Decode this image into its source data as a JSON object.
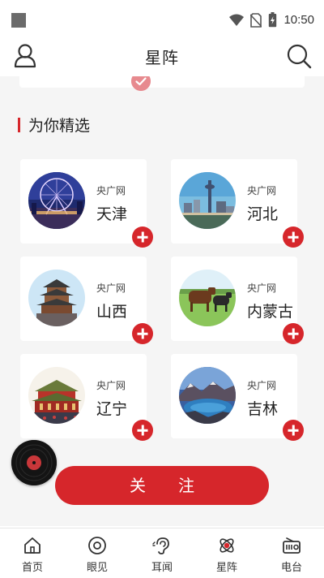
{
  "status_bar": {
    "time": "10:50"
  },
  "header": {
    "title": "星阵"
  },
  "section": {
    "title": "为你精选"
  },
  "cards": [
    {
      "source": "央广网",
      "name": "天津",
      "image": "tianjin-eye-ferris-wheel"
    },
    {
      "source": "央广网",
      "name": "河北",
      "image": "hebei-city-tower"
    },
    {
      "source": "央广网",
      "name": "山西",
      "image": "shanxi-pavilion"
    },
    {
      "source": "央广网",
      "name": "内蒙古",
      "image": "inner-mongolia-cattle"
    },
    {
      "source": "央广网",
      "name": "辽宁",
      "image": "liaoning-palace"
    },
    {
      "source": "央广网",
      "name": "吉林",
      "image": "jilin-tianchi-lake"
    }
  ],
  "follow_button": {
    "label": "关注"
  },
  "bottom_nav": [
    {
      "label": "首页",
      "icon": "home-icon"
    },
    {
      "label": "眼见",
      "icon": "eye-icon"
    },
    {
      "label": "耳闻",
      "icon": "ear-icon"
    },
    {
      "label": "星阵",
      "icon": "star-array-icon"
    },
    {
      "label": "电台",
      "icon": "radio-icon"
    }
  ],
  "colors": {
    "accent": "#d6262b",
    "background": "#f5f5f5",
    "check_faded": "#e78a8f"
  }
}
